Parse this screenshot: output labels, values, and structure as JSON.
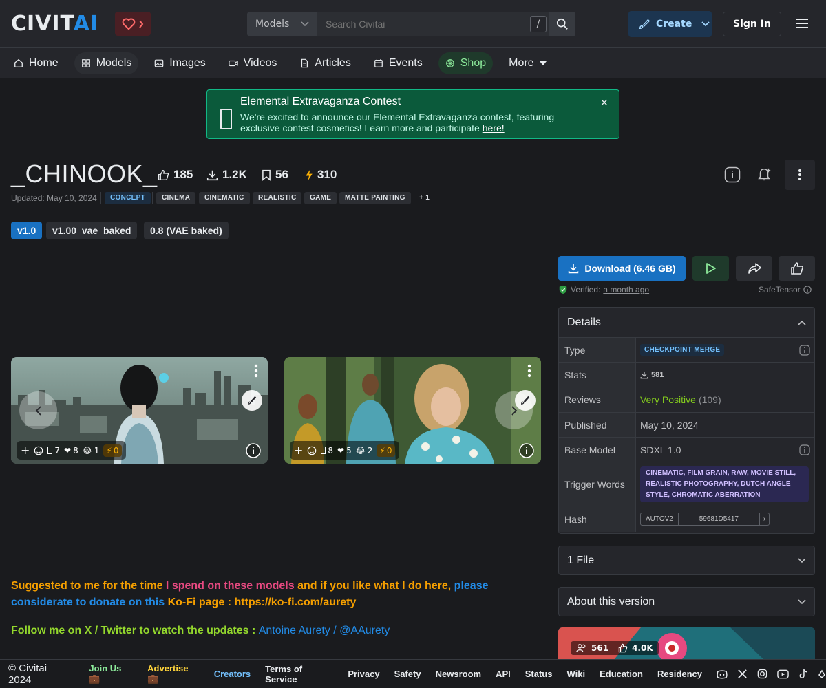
{
  "header": {
    "logo_main": "CIVIT",
    "logo_accent": "AI",
    "search_scope": "Models",
    "search_placeholder": "Search Civitai",
    "search_shortcut": "/",
    "create_label": "Create",
    "signin_label": "Sign In"
  },
  "nav": {
    "items": [
      {
        "label": "Home",
        "icon": "home-icon"
      },
      {
        "label": "Models",
        "icon": "models-icon"
      },
      {
        "label": "Images",
        "icon": "image-icon"
      },
      {
        "label": "Videos",
        "icon": "video-icon"
      },
      {
        "label": "Articles",
        "icon": "article-icon"
      },
      {
        "label": "Events",
        "icon": "calendar-icon"
      },
      {
        "label": "Shop",
        "icon": "shop-icon"
      },
      {
        "label": "More",
        "icon": "caret-down-icon"
      }
    ]
  },
  "alert": {
    "title": "Elemental Extravaganza Contest",
    "message": "We're excited to announce our Elemental Extravaganza contest, featuring exclusive contest cosmetics! Learn more and participate ",
    "link": "here!"
  },
  "model": {
    "title": "_CHINOOK_",
    "likes": "185",
    "downloads": "1.2K",
    "collections": "56",
    "buzz": "310",
    "updated": "Updated: May 10, 2024",
    "tags": [
      "CONCEPT",
      "CINEMA",
      "CINEMATIC",
      "REALISTIC",
      "GAME",
      "MATTE PAINTING",
      "+ 1"
    ],
    "versions": [
      "v1.0",
      "v1.00_vae_baked",
      "0.8 (VAE baked)"
    ]
  },
  "gallery": [
    {
      "comments": "7",
      "hearts": "8",
      "laughs": "1",
      "buzz": "0"
    },
    {
      "comments": "8",
      "hearts": "5",
      "laughs": "2",
      "buzz": "0"
    }
  ],
  "description": {
    "p1_a": "Suggested to me for the time ",
    "p1_b": "I spend on these models",
    "p1_c": " and if you like what I do here, ",
    "p1_d": "please considerate to donate on this",
    "p1_e": " Ko-Fi page : https://ko-fi.com/aurety",
    "p2_a": "Follow me on X / Twitter to watch the updates : ",
    "p2_b": "Antoine Aurety / @AAurety"
  },
  "sidebar": {
    "download_label": "Download (6.46 GB)",
    "verified_prefix": "Verified:",
    "verified_when": "a month ago",
    "safetensor": "SafeTensor",
    "details_title": "Details",
    "rows": {
      "type_k": "Type",
      "type_v": "CHECKPOINT MERGE",
      "stats_k": "Stats",
      "stats_v": "581",
      "reviews_k": "Reviews",
      "reviews_v": "Very Positive",
      "reviews_count": "(109)",
      "published_k": "Published",
      "published_v": "May 10, 2024",
      "base_k": "Base Model",
      "base_v": "SDXL 1.0",
      "trigger_k": "Trigger Words",
      "trigger_v": "CINEMATIC, FILM GRAIN, RAW, MOVIE STILL, REALISTIC PHOTOGRAPHY, DUTCH ANGLE STYLE, CHROMATIC ABERRATION",
      "hash_k": "Hash",
      "hash_type": "AUTOV2",
      "hash_v": "59681D5417"
    },
    "files_label": "1 File",
    "about_label": "About this version",
    "thumb_count": "561",
    "thumb_likes": "4.0K"
  },
  "footer": {
    "copy": "© Civitai 2024",
    "links": [
      "Join Us 💼",
      "Advertise 💼",
      "Creators",
      "Terms of Service",
      "Privacy",
      "Safety",
      "Newsroom",
      "API",
      "Status",
      "Wiki",
      "Education",
      "Residency"
    ]
  },
  "colors": {
    "accent": "#1971c2",
    "success": "#12b886",
    "warning": "#fab005"
  }
}
